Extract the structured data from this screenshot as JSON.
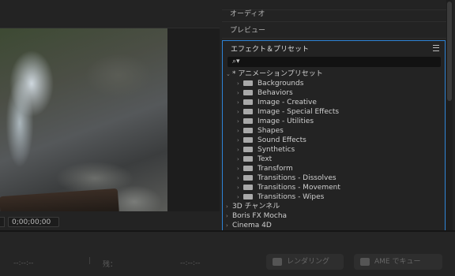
{
  "panels": {
    "audio": "オーディオ",
    "preview": "プレビュー",
    "effects_title": "エフェクト＆プリセット"
  },
  "search": {
    "icon": "search-icon"
  },
  "timecode": "0;00;00;00",
  "tree": [
    {
      "label": "* アニメーションプリセット",
      "level": 0,
      "expanded": true,
      "folder": false
    },
    {
      "label": "Backgrounds",
      "level": 1,
      "folder": true
    },
    {
      "label": "Behaviors",
      "level": 1,
      "folder": true
    },
    {
      "label": "Image - Creative",
      "level": 1,
      "folder": true
    },
    {
      "label": "Image - Special Effects",
      "level": 1,
      "folder": true
    },
    {
      "label": "Image - Utilities",
      "level": 1,
      "folder": true
    },
    {
      "label": "Shapes",
      "level": 1,
      "folder": true
    },
    {
      "label": "Sound Effects",
      "level": 1,
      "folder": true
    },
    {
      "label": "Synthetics",
      "level": 1,
      "folder": true
    },
    {
      "label": "Text",
      "level": 1,
      "folder": true
    },
    {
      "label": "Transform",
      "level": 1,
      "folder": true
    },
    {
      "label": "Transitions - Dissolves",
      "level": 1,
      "folder": true
    },
    {
      "label": "Transitions - Movement",
      "level": 1,
      "folder": true
    },
    {
      "label": "Transitions - Wipes",
      "level": 1,
      "folder": true
    },
    {
      "label": "3D チャンネル",
      "level": 0,
      "folder": false
    },
    {
      "label": "Boris FX Mocha",
      "level": 0,
      "folder": false
    },
    {
      "label": "Cinema 4D",
      "level": 0,
      "folder": false
    }
  ],
  "bottom": {
    "time_left": "--:--:--",
    "remaining_label": "残：",
    "time_right": "--:--:--",
    "render_button": "レンダリング",
    "ame_button": "AME でキュー"
  },
  "colors": {
    "accent": "#2d83d6"
  }
}
